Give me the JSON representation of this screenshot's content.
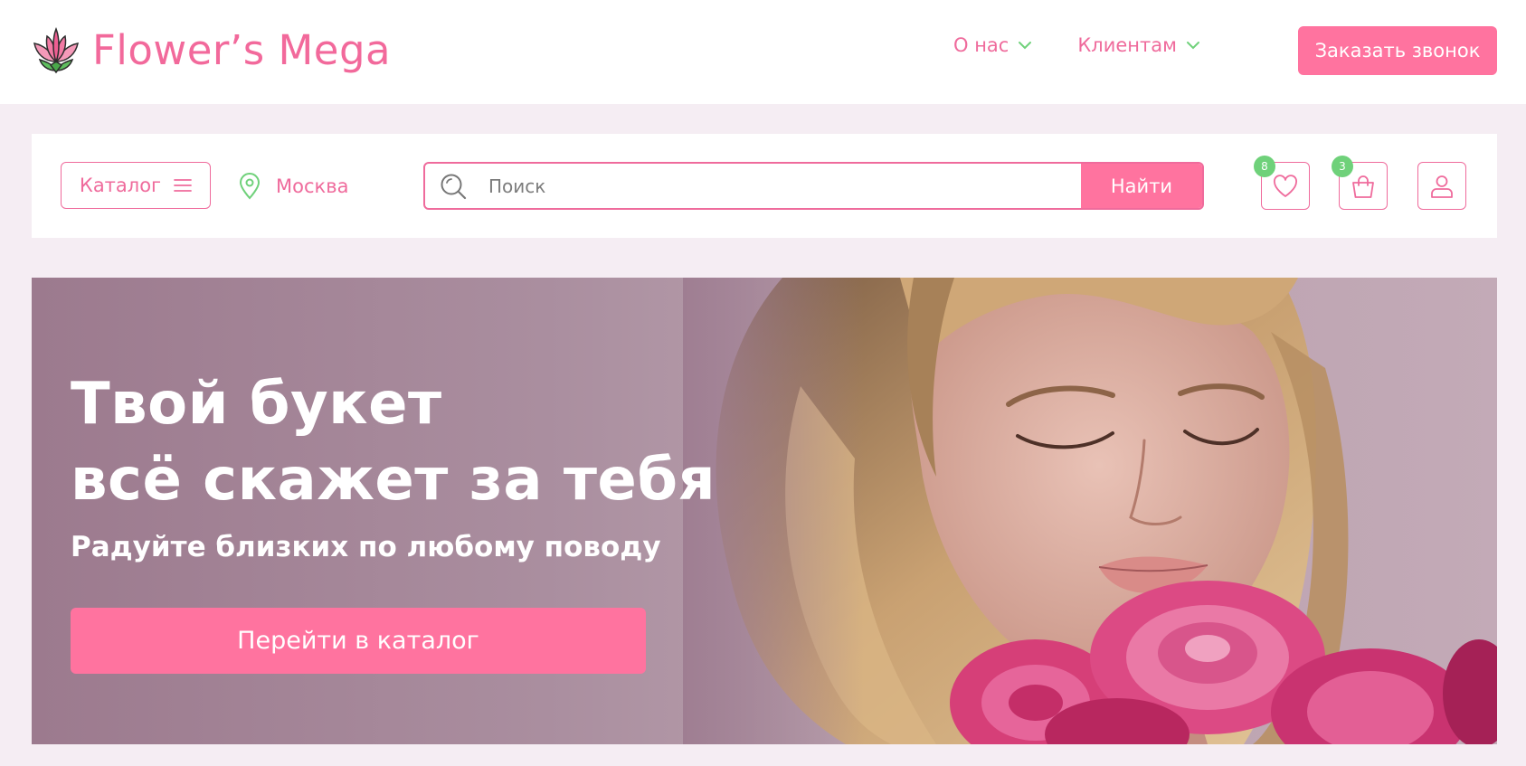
{
  "header": {
    "logo_text": "Flower’s Mega",
    "nav": [
      {
        "label": "О нас"
      },
      {
        "label": "Клиентам"
      }
    ],
    "callback_label": "Заказать звонок"
  },
  "searchbar": {
    "catalog_label": "Каталог",
    "city": "Москва",
    "search_placeholder": "Поиск",
    "search_button": "Найти",
    "favorites_count": "8",
    "cart_count": "3"
  },
  "hero": {
    "title": "Твой букет\nвсё скажет за тебя",
    "subtitle": "Радуйте близких по любому поводу",
    "cta_label": "Перейти в каталог"
  },
  "colors": {
    "accent": "#ff739f",
    "accent_text": "#ef6b9c",
    "badge": "#6fd17a",
    "background": "#f5edf3"
  }
}
